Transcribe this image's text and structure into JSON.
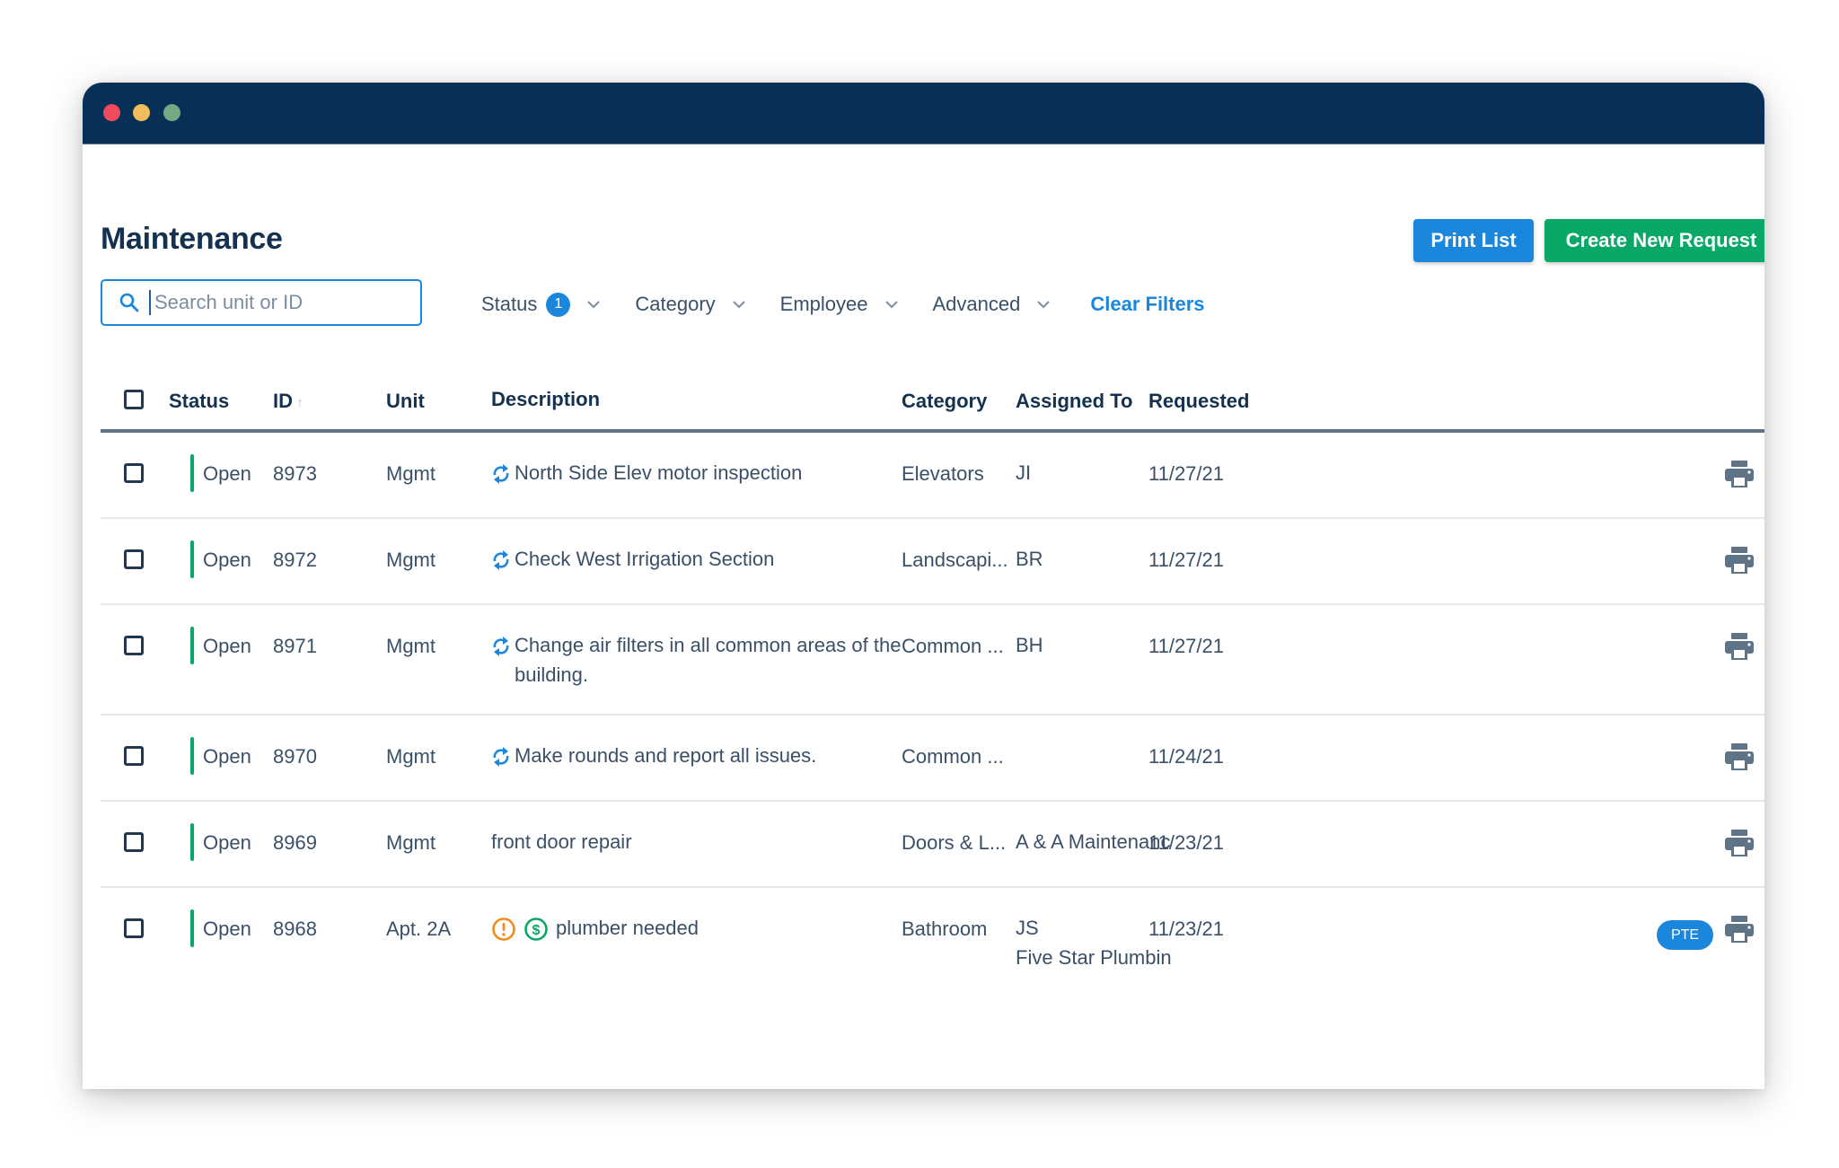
{
  "window": {
    "titlebar_color": "#082f55"
  },
  "page": {
    "title": "Maintenance"
  },
  "search": {
    "placeholder": "Search unit or ID",
    "value": ""
  },
  "filters": {
    "status": {
      "label": "Status",
      "badge": "1"
    },
    "category": {
      "label": "Category"
    },
    "employee": {
      "label": "Employee"
    },
    "advanced": {
      "label": "Advanced"
    },
    "clear_label": "Clear Filters"
  },
  "actions": {
    "print_label": "Print List",
    "create_label": "Create New Request"
  },
  "colors": {
    "primary": "#1a86dc",
    "success": "#09a866",
    "warning": "#f28a1c",
    "text": "#3a5068",
    "heading": "#14314f"
  },
  "table": {
    "columns": {
      "status": "Status",
      "id": "ID",
      "id_sort": "↑",
      "unit": "Unit",
      "description": "Description",
      "category": "Category",
      "assigned": "Assigned To",
      "requested": "Requested"
    },
    "rows": [
      {
        "status": "Open",
        "id": "8973",
        "unit": "Mgmt",
        "recurring": true,
        "description": "North Side Elev motor inspection",
        "category": "Elevators",
        "assigned": "JI",
        "assigned_2": "",
        "requested": "11/27/21",
        "badge": ""
      },
      {
        "status": "Open",
        "id": "8972",
        "unit": "Mgmt",
        "recurring": true,
        "description": "Check West Irrigation Section",
        "category": "Landscapi...",
        "assigned": "BR",
        "assigned_2": "",
        "requested": "11/27/21",
        "badge": ""
      },
      {
        "status": "Open",
        "id": "8971",
        "unit": "Mgmt",
        "recurring": true,
        "description": "Change air filters in all common areas of the building.",
        "category": "Common ...",
        "assigned": "BH",
        "assigned_2": "",
        "requested": "11/27/21",
        "badge": ""
      },
      {
        "status": "Open",
        "id": "8970",
        "unit": "Mgmt",
        "recurring": true,
        "description": "Make rounds and report all issues.",
        "category": "Common ...",
        "assigned": "",
        "assigned_2": "",
        "requested": "11/24/21",
        "badge": ""
      },
      {
        "status": "Open",
        "id": "8969",
        "unit": "Mgmt",
        "recurring": false,
        "description": "front door repair",
        "category": "Doors & L...",
        "assigned": "A & A Maintenanc",
        "assigned_2": "",
        "requested": "11/23/21",
        "badge": ""
      },
      {
        "status": "Open",
        "id": "8968",
        "unit": "Apt. 2A",
        "recurring": false,
        "urgent": true,
        "billable": true,
        "description": "plumber needed",
        "category": "Bathroom",
        "assigned": "JS",
        "assigned_2": "Five Star Plumbin",
        "requested": "11/23/21",
        "badge": "PTE"
      }
    ]
  }
}
